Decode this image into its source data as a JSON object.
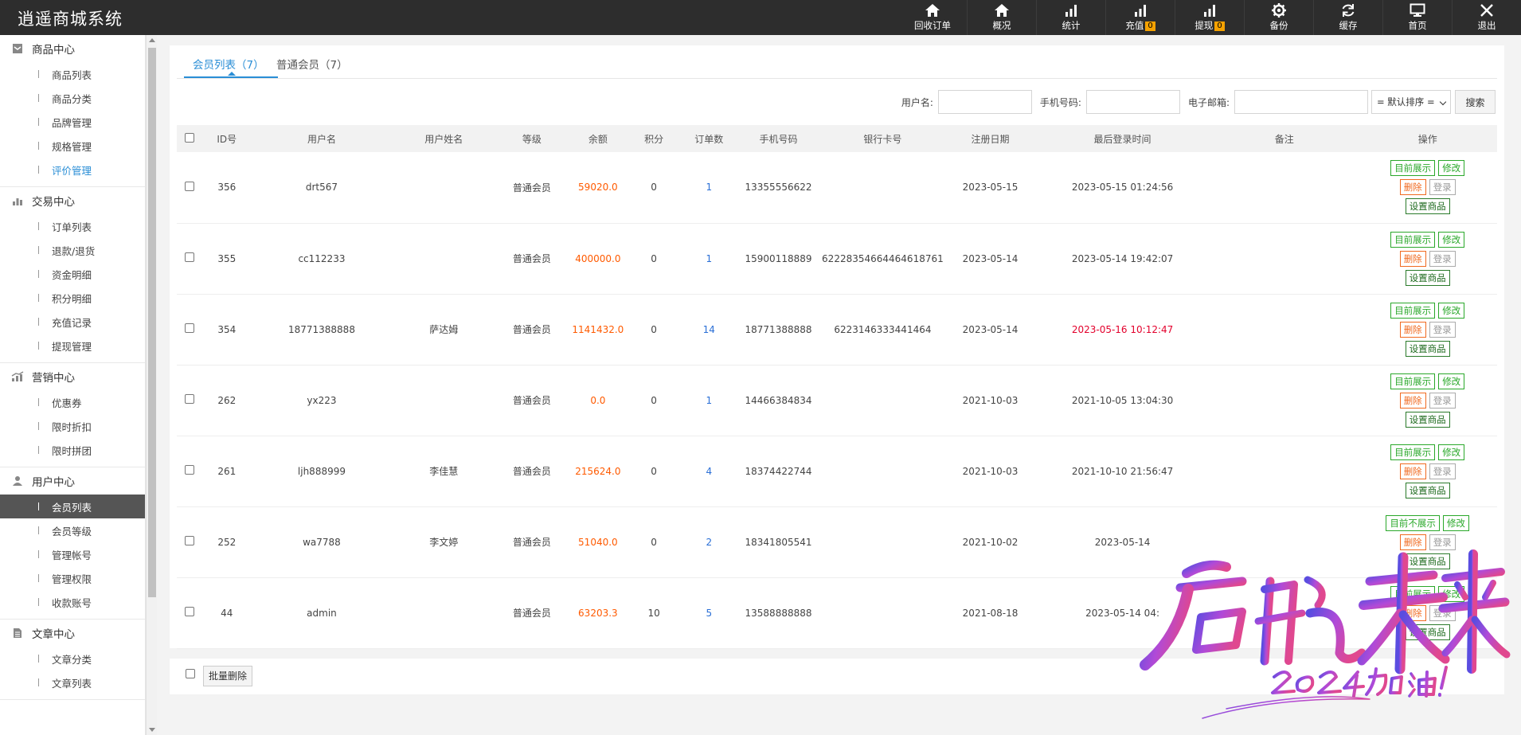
{
  "app": {
    "title": "逍遥商城系统"
  },
  "topnav": [
    {
      "label": "回收订单",
      "icon": "home-icon",
      "badge": null
    },
    {
      "label": "概况",
      "icon": "home-icon",
      "badge": null
    },
    {
      "label": "统计",
      "icon": "bar-chart-icon",
      "badge": null
    },
    {
      "label": "充值",
      "icon": "bar-chart-icon",
      "badge": "0"
    },
    {
      "label": "提现",
      "icon": "bar-chart-icon",
      "badge": "0"
    },
    {
      "label": "备份",
      "icon": "gear-icon",
      "badge": null
    },
    {
      "label": "缓存",
      "icon": "refresh-icon",
      "badge": null
    },
    {
      "label": "首页",
      "icon": "monitor-icon",
      "badge": null
    },
    {
      "label": "退出",
      "icon": "close-icon",
      "badge": null
    }
  ],
  "sidebar": {
    "groups": [
      {
        "title": "商品中心",
        "icon": "box-icon",
        "items": [
          "商品列表",
          "商品分类",
          "品牌管理",
          "规格管理",
          "评价管理"
        ]
      },
      {
        "title": "交易中心",
        "icon": "bar-chart-icon",
        "items": [
          "订单列表",
          "退款/退货",
          "资金明细",
          "积分明细",
          "充值记录",
          "提现管理"
        ]
      },
      {
        "title": "营销中心",
        "icon": "growth-chart-icon",
        "items": [
          "优惠券",
          "限时折扣",
          "限时拼团"
        ]
      },
      {
        "title": "用户中心",
        "icon": "user-icon",
        "items": [
          "会员列表",
          "会员等级",
          "管理帐号",
          "管理权限",
          "收款账号"
        ]
      },
      {
        "title": "文章中心",
        "icon": "document-icon",
        "items": [
          "文章分类",
          "文章列表"
        ]
      }
    ],
    "active_item": "会员列表",
    "link_item": "评价管理"
  },
  "tabs": [
    {
      "label": "会员列表（7）",
      "active": true
    },
    {
      "label": "普通会员（7）",
      "active": false
    }
  ],
  "search": {
    "username_label": "用户名:",
    "username_value": "",
    "phone_label": "手机号码:",
    "phone_value": "",
    "email_label": "电子邮箱:",
    "email_value": "",
    "sort_selected": "= 默认排序 =",
    "search_button": "搜索"
  },
  "table": {
    "headers": [
      "ID号",
      "用户名",
      "用户姓名",
      "等级",
      "余额",
      "积分",
      "订单数",
      "手机号码",
      "银行卡号",
      "注册日期",
      "最后登录时间",
      "备注",
      "操作"
    ],
    "rows": [
      {
        "id": "356",
        "username": "drt567",
        "realname": "",
        "level": "普通会员",
        "balance": "59020.0",
        "points": "0",
        "orders": "1",
        "phone": "13355556622",
        "bank": "",
        "reg_date": "2023-05-15",
        "last_login": "2023-05-15 01:24:56",
        "last_login_highlight": false,
        "note": "",
        "show_label": "目前展示"
      },
      {
        "id": "355",
        "username": "cc112233",
        "realname": "",
        "level": "普通会员",
        "balance": "400000.0",
        "points": "0",
        "orders": "1",
        "phone": "15900118889",
        "bank": "622283546644646​18761",
        "reg_date": "2023-05-14",
        "last_login": "2023-05-14 19:42:07",
        "last_login_highlight": false,
        "note": "",
        "show_label": "目前展示"
      },
      {
        "id": "354",
        "username": "18771388888",
        "realname": "萨达姆",
        "level": "普通会员",
        "balance": "1141432.0",
        "points": "0",
        "orders": "14",
        "phone": "18771388888",
        "bank": "6223146333441464",
        "reg_date": "2023-05-14",
        "last_login": "2023-05-16 10:12:47",
        "last_login_highlight": true,
        "note": "",
        "show_label": "目前展示"
      },
      {
        "id": "262",
        "username": "yx223",
        "realname": "",
        "level": "普通会员",
        "balance": "0.0",
        "points": "0",
        "orders": "1",
        "phone": "14466384834",
        "bank": "",
        "reg_date": "2021-10-03",
        "last_login": "2021-10-05 13:04:30",
        "last_login_highlight": false,
        "note": "",
        "show_label": "目前展示"
      },
      {
        "id": "261",
        "username": "ljh888999",
        "realname": "李佳慧",
        "level": "普通会员",
        "balance": "215624.0",
        "points": "0",
        "orders": "4",
        "phone": "18374422744",
        "bank": "",
        "reg_date": "2021-10-03",
        "last_login": "2021-10-10 21:56:47",
        "last_login_highlight": false,
        "note": "",
        "show_label": "目前展示"
      },
      {
        "id": "252",
        "username": "wa7788",
        "realname": "李文婷",
        "level": "普通会员",
        "balance": "51040.0",
        "points": "0",
        "orders": "2",
        "phone": "18341805541",
        "bank": "",
        "reg_date": "2021-10-02",
        "last_login": "2023-05-14 ",
        "last_login_highlight": false,
        "note": "",
        "show_label": "目前不展示"
      },
      {
        "id": "44",
        "username": "admin",
        "realname": "",
        "level": "普通会员",
        "balance": "63203.3",
        "points": "10",
        "orders": "5",
        "phone": "13588888888",
        "bank": "",
        "reg_date": "2021-08-18",
        "last_login": "2023-05-14 04:",
        "last_login_highlight": false,
        "note": "",
        "show_label": "目前展示"
      }
    ],
    "op_labels": {
      "edit": "修改",
      "delete": "删除",
      "login": "登录",
      "set_goods": "设置商品"
    }
  },
  "footer": {
    "batch_delete": "批量删除"
  },
  "watermark": {
    "text_main": "启航未来",
    "text_sub": "2024加油!"
  },
  "colors": {
    "topbar": "#2d2d2d",
    "accent": "#2a8ed6",
    "amount": "#ff5a00",
    "count": "#2a6fd6",
    "highlight": "#e3002c"
  }
}
